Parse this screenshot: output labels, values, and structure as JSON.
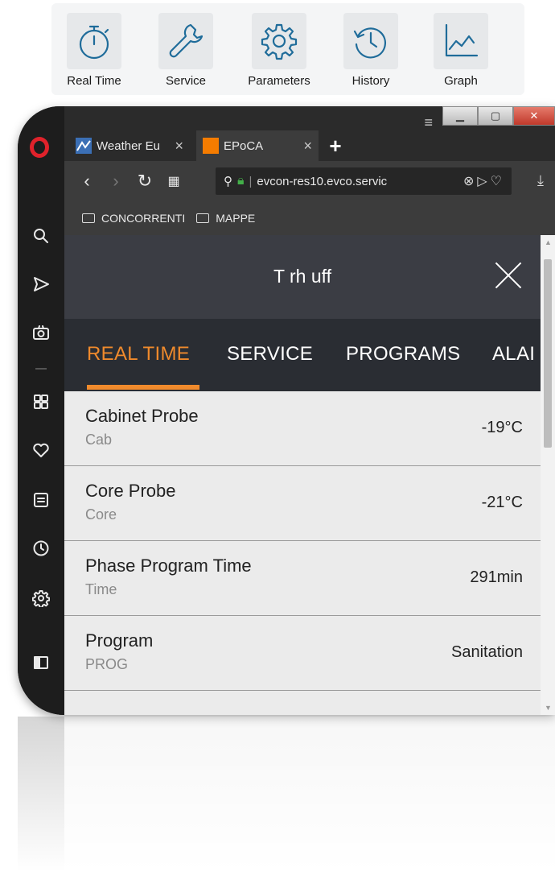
{
  "toolbar": {
    "items": [
      {
        "label": "Real Time",
        "icon": "stopwatch-icon"
      },
      {
        "label": "Service",
        "icon": "wrench-icon"
      },
      {
        "label": "Parameters",
        "icon": "gear-icon"
      },
      {
        "label": "History",
        "icon": "history-icon"
      },
      {
        "label": "Graph",
        "icon": "line-chart-icon"
      }
    ],
    "accent": "#1f6c9a"
  },
  "browser": {
    "tabs": [
      {
        "label": "Weather Eu",
        "close": "×"
      },
      {
        "label": "EPoCA",
        "close": "×"
      }
    ],
    "new_tab": "+",
    "url": "evcon-res10.evco.servic",
    "bookmarks": [
      "CONCORRENTI",
      "MAPPE"
    ]
  },
  "app": {
    "title": "T rh uff",
    "accent": "#f08a2c",
    "tabs": [
      "REAL TIME",
      "SERVICE",
      "PROGRAMS",
      "ALAI"
    ],
    "rows": [
      {
        "name": "Cabinet Probe",
        "sub": "Cab",
        "value": "-19°C"
      },
      {
        "name": "Core Probe",
        "sub": "Core",
        "value": "-21°C"
      },
      {
        "name": "Phase Program Time",
        "sub": "Time",
        "value": "291min"
      },
      {
        "name": "Program",
        "sub": "PROG",
        "value": "Sanitation"
      }
    ]
  }
}
